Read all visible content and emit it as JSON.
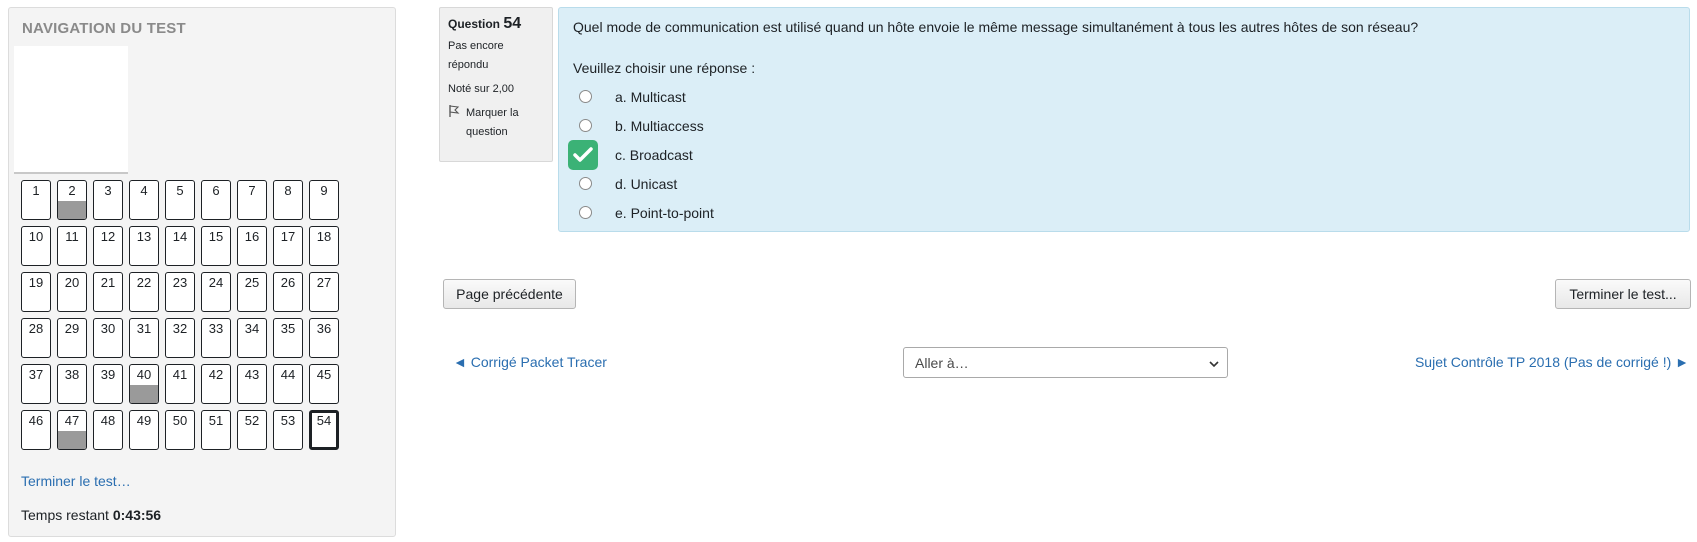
{
  "nav": {
    "title": "NAVIGATION DU TEST",
    "questions": [
      {
        "n": "1",
        "answered": false
      },
      {
        "n": "2",
        "answered": true
      },
      {
        "n": "3",
        "answered": false
      },
      {
        "n": "4",
        "answered": false
      },
      {
        "n": "5",
        "answered": false
      },
      {
        "n": "6",
        "answered": false
      },
      {
        "n": "7",
        "answered": false
      },
      {
        "n": "8",
        "answered": false
      },
      {
        "n": "9",
        "answered": false
      },
      {
        "n": "10",
        "answered": false
      },
      {
        "n": "11",
        "answered": false
      },
      {
        "n": "12",
        "answered": false
      },
      {
        "n": "13",
        "answered": false
      },
      {
        "n": "14",
        "answered": false
      },
      {
        "n": "15",
        "answered": false
      },
      {
        "n": "16",
        "answered": false
      },
      {
        "n": "17",
        "answered": false
      },
      {
        "n": "18",
        "answered": false
      },
      {
        "n": "19",
        "answered": false
      },
      {
        "n": "20",
        "answered": false
      },
      {
        "n": "21",
        "answered": false
      },
      {
        "n": "22",
        "answered": false
      },
      {
        "n": "23",
        "answered": false
      },
      {
        "n": "24",
        "answered": false
      },
      {
        "n": "25",
        "answered": false
      },
      {
        "n": "26",
        "answered": false
      },
      {
        "n": "27",
        "answered": false
      },
      {
        "n": "28",
        "answered": false
      },
      {
        "n": "29",
        "answered": false
      },
      {
        "n": "30",
        "answered": false
      },
      {
        "n": "31",
        "answered": false
      },
      {
        "n": "32",
        "answered": false
      },
      {
        "n": "33",
        "answered": false
      },
      {
        "n": "34",
        "answered": false
      },
      {
        "n": "35",
        "answered": false
      },
      {
        "n": "36",
        "answered": false
      },
      {
        "n": "37",
        "answered": false
      },
      {
        "n": "38",
        "answered": false
      },
      {
        "n": "39",
        "answered": false
      },
      {
        "n": "40",
        "answered": true
      },
      {
        "n": "41",
        "answered": false
      },
      {
        "n": "42",
        "answered": false
      },
      {
        "n": "43",
        "answered": false
      },
      {
        "n": "44",
        "answered": false
      },
      {
        "n": "45",
        "answered": false
      },
      {
        "n": "46",
        "answered": false
      },
      {
        "n": "47",
        "answered": true
      },
      {
        "n": "48",
        "answered": false
      },
      {
        "n": "49",
        "answered": false
      },
      {
        "n": "50",
        "answered": false
      },
      {
        "n": "51",
        "answered": false
      },
      {
        "n": "52",
        "answered": false
      },
      {
        "n": "53",
        "answered": false
      },
      {
        "n": "54",
        "answered": false,
        "current": true
      }
    ],
    "finish_link": "Terminer le test…",
    "timer_label": "Temps restant",
    "timer_value": "0:43:56"
  },
  "qinfo": {
    "label": "Question",
    "number": "54",
    "status": "Pas encore répondu",
    "grade": "Noté sur 2,00",
    "flag_label": "Marquer la question"
  },
  "question": {
    "text": "Quel mode de communication est utilisé quand un hôte envoie le même message simultanément à tous les autres hôtes de son réseau?",
    "prompt": "Veuillez choisir une réponse :",
    "answers": [
      {
        "label": "a. Multicast",
        "checked": false
      },
      {
        "label": "b. Multiaccess",
        "checked": false
      },
      {
        "label": "c. Broadcast",
        "checked": true
      },
      {
        "label": "d. Unicast",
        "checked": false
      },
      {
        "label": "e. Point-to-point",
        "checked": false
      }
    ]
  },
  "buttons": {
    "prev_page": "Page précédente",
    "finish": "Terminer le test..."
  },
  "footer": {
    "prev_link": "◄ Corrigé Packet Tracer",
    "jump_placeholder": "Aller à…",
    "next_link": "Sujet Contrôle TP 2018 (Pas de corrigé !) ►"
  },
  "colors": {
    "link": "#2a6eb0",
    "check": "#3bb276",
    "question_bg": "#dbeef7"
  }
}
